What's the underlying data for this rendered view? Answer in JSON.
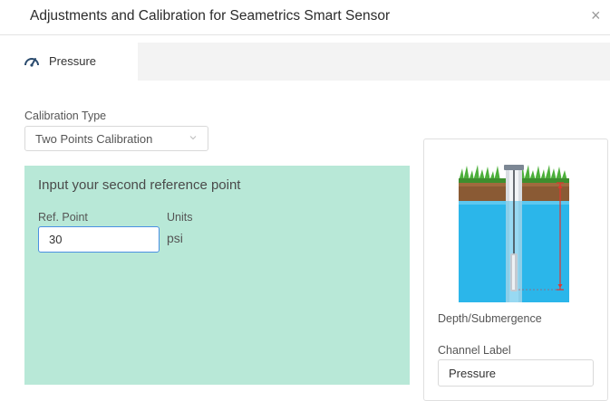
{
  "dialog": {
    "title": "Adjustments and Calibration for Seametrics Smart Sensor",
    "close_glyph": "×"
  },
  "tabs": [
    {
      "label": "Pressure",
      "icon": "gauge-icon",
      "active": true
    }
  ],
  "calibration": {
    "type_label": "Calibration Type",
    "type_value": "Two Points Calibration"
  },
  "reference_panel": {
    "title": "Input your second reference point",
    "ref_point_label": "Ref. Point",
    "ref_point_value": "30",
    "units_label": "Units",
    "units_value": "psi",
    "background_color": "#b8e8d7"
  },
  "sensor_card": {
    "illustration": "well-sensor-illustration",
    "measurement_label": "Depth/Submergence",
    "channel_label": "Channel Label",
    "channel_value": "Pressure"
  },
  "colors": {
    "input_focus_border": "#4a90e2",
    "water": "#2bb6ea",
    "depth_indicator": "#e0362f"
  }
}
